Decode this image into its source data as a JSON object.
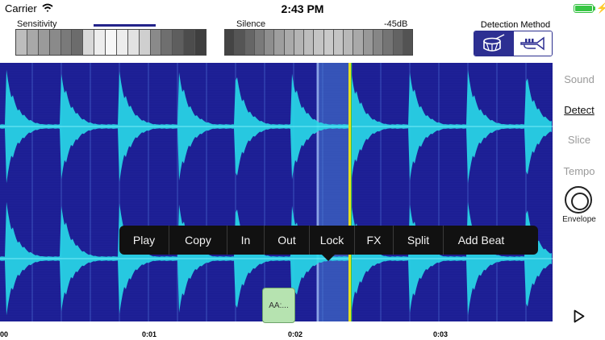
{
  "status_bar": {
    "carrier": "Carrier",
    "time": "2:43 PM"
  },
  "meters": {
    "sensitivity": {
      "label": "Sensitivity",
      "segments": [
        "#bdbdbd",
        "#a8a8a8",
        "#9a9a9a",
        "#8a8a8a",
        "#7a7a7a",
        "#6c6c6c",
        "#d8d8d8",
        "#ededed",
        "#f7f7f7",
        "#ededed",
        "#e2e2e2",
        "#cfcfcf",
        "#8a8a8a",
        "#6f6f6f",
        "#5e5e5e",
        "#4c4c4c",
        "#3f3f3f"
      ]
    },
    "silence": {
      "label": "Silence",
      "value": "-45dB",
      "segments": [
        "#444444",
        "#555555",
        "#666666",
        "#7a7a7a",
        "#8e8e8e",
        "#9e9e9e",
        "#aaaaaa",
        "#b4b4b4",
        "#bdbdbd",
        "#c4c4c4",
        "#c9c9c9",
        "#c4c4c4",
        "#b8b8b8",
        "#a9a9a9",
        "#989898",
        "#868686",
        "#747474",
        "#636363",
        "#535353"
      ]
    },
    "detection_method": {
      "label": "Detection Method",
      "options": [
        "drum-icon",
        "trumpet-icon"
      ],
      "selected": "drum-icon"
    }
  },
  "side_menu": {
    "items": [
      {
        "id": "sound",
        "label": "Sound"
      },
      {
        "id": "detect",
        "label": "Detect"
      },
      {
        "id": "slice",
        "label": "Slice"
      },
      {
        "id": "tempo",
        "label": "Tempo"
      }
    ],
    "envelope_label": "Envelope"
  },
  "context_menu": {
    "items": [
      {
        "label": "Play"
      },
      {
        "label": "Copy"
      },
      {
        "label": "In"
      },
      {
        "label": "Out"
      },
      {
        "label": "Lock"
      },
      {
        "label": "FX"
      },
      {
        "label": "Split"
      },
      {
        "label": "Add Beat"
      }
    ]
  },
  "marker_tag": "AA:...",
  "timeline": {
    "labels": [
      "00",
      "0:01",
      "0:02",
      "0:03"
    ]
  },
  "colors": {
    "wave_bg": "#1c1e93",
    "wave_fill": "#28d7e6",
    "selection": "#4a7fd6",
    "playhead": "#e6df1f"
  }
}
